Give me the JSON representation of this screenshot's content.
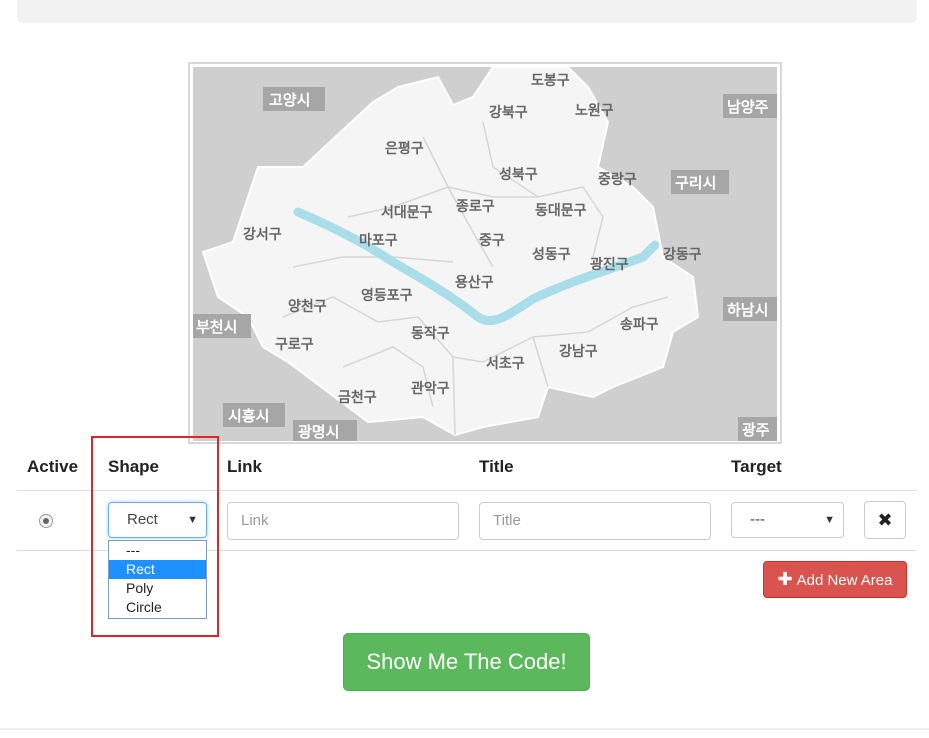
{
  "map": {
    "labels": [
      {
        "id": "dobong",
        "text": "도봉구"
      },
      {
        "id": "gangbuk",
        "text": "강북구"
      },
      {
        "id": "nowon",
        "text": "노원구"
      },
      {
        "id": "eunpyeong",
        "text": "은평구"
      },
      {
        "id": "seongbuk",
        "text": "성북구"
      },
      {
        "id": "jungnang",
        "text": "중랑구"
      },
      {
        "id": "seodaemun",
        "text": "서대문구"
      },
      {
        "id": "jongno",
        "text": "종로구"
      },
      {
        "id": "dongdaemun",
        "text": "동대문구"
      },
      {
        "id": "gangseo",
        "text": "강서구"
      },
      {
        "id": "mapo",
        "text": "마포구"
      },
      {
        "id": "jung",
        "text": "중구"
      },
      {
        "id": "seongdong",
        "text": "성동구"
      },
      {
        "id": "gwangjin",
        "text": "광진구"
      },
      {
        "id": "gangdong",
        "text": "강동구"
      },
      {
        "id": "yongsan",
        "text": "용산구"
      },
      {
        "id": "yangcheon",
        "text": "양천구"
      },
      {
        "id": "yeongdeungpo",
        "text": "영등포구"
      },
      {
        "id": "guro",
        "text": "구로구"
      },
      {
        "id": "dongjak",
        "text": "동작구"
      },
      {
        "id": "songpa",
        "text": "송파구"
      },
      {
        "id": "seocho",
        "text": "서초구"
      },
      {
        "id": "gangnam",
        "text": "강남구"
      },
      {
        "id": "geumcheon",
        "text": "금천구"
      },
      {
        "id": "gwanak",
        "text": "관악구"
      }
    ],
    "city_labels": [
      {
        "id": "goyang",
        "text": "고양시"
      },
      {
        "id": "namyangju",
        "text": "남양주"
      },
      {
        "id": "guri",
        "text": "구리시"
      },
      {
        "id": "bucheon",
        "text": "부천시"
      },
      {
        "id": "hanam",
        "text": "하남시"
      },
      {
        "id": "siheung",
        "text": "시흥시"
      },
      {
        "id": "gwangmyeong",
        "text": "광명시"
      },
      {
        "id": "gwangju",
        "text": "광주"
      }
    ]
  },
  "table": {
    "headers": {
      "active": "Active",
      "shape": "Shape",
      "link": "Link",
      "title": "Title",
      "target": "Target"
    },
    "row": {
      "shape_value": "Rect",
      "link_placeholder": "Link",
      "title_placeholder": "Title",
      "target_value": "---",
      "delete_icon": "✖"
    }
  },
  "shape_options": [
    "---",
    "Rect",
    "Poly",
    "Circle"
  ],
  "buttons": {
    "add_area": "Add New Area",
    "show_code": "Show Me The Code!"
  },
  "colors": {
    "danger": "#d9534f",
    "success": "#5cb85c",
    "highlight": "#e0242c",
    "river": "#a9dde9"
  }
}
